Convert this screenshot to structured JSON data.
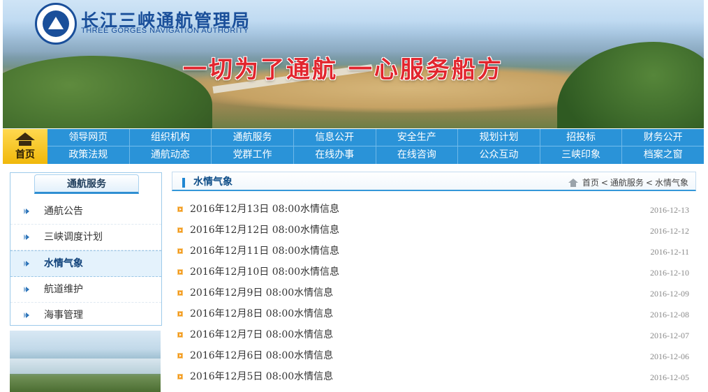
{
  "header": {
    "org_name_cn": "长江三峡通航管理局",
    "org_name_en": "THREE GORGES NAVIGATION AUTHORITY",
    "slogan": "一切为了通航  一心服务船方",
    "logo_icon": "authority-emblem"
  },
  "nav": {
    "home_label": "首页",
    "row1": [
      "领导网页",
      "组织机构",
      "通航服务",
      "信息公开",
      "安全生产",
      "规划计划",
      "招投标",
      "财务公开"
    ],
    "row2": [
      "政策法规",
      "通航动态",
      "党群工作",
      "在线办事",
      "在线咨询",
      "公众互动",
      "三峡印象",
      "档案之窗"
    ],
    "color": "#2a93d8"
  },
  "sidebar": {
    "title": "通航服务",
    "items": [
      {
        "label": "通航公告",
        "active": false
      },
      {
        "label": "三峡调度计划",
        "active": false
      },
      {
        "label": "水情气象",
        "active": true
      },
      {
        "label": "航道维护",
        "active": false
      },
      {
        "label": "海事管理",
        "active": false
      }
    ]
  },
  "main": {
    "title": "水情气象",
    "breadcrumb": {
      "home": "首页",
      "sep": "<",
      "level1": "通航服务",
      "level2": "水情气象"
    },
    "rows": [
      {
        "title": "2016年12月13日 08:00水情信息",
        "date": "2016-12-13"
      },
      {
        "title": "2016年12月12日 08:00水情信息",
        "date": "2016-12-12"
      },
      {
        "title": "2016年12月11日 08:00水情信息",
        "date": "2016-12-11"
      },
      {
        "title": "2016年12月10日 08:00水情信息",
        "date": "2016-12-10"
      },
      {
        "title": "2016年12月9日 08:00水情信息",
        "date": "2016-12-09"
      },
      {
        "title": "2016年12月8日 08:00水情信息",
        "date": "2016-12-08"
      },
      {
        "title": "2016年12月7日 08:00水情信息",
        "date": "2016-12-07"
      },
      {
        "title": "2016年12月6日 08:00水情信息",
        "date": "2016-12-06"
      },
      {
        "title": "2016年12月5日 08:00水情信息",
        "date": "2016-12-05"
      }
    ]
  },
  "colors": {
    "accent": "#2a93d8",
    "slogan": "#e2262e",
    "home_button": "#f0b80b",
    "bullet": "#f39a1e"
  }
}
